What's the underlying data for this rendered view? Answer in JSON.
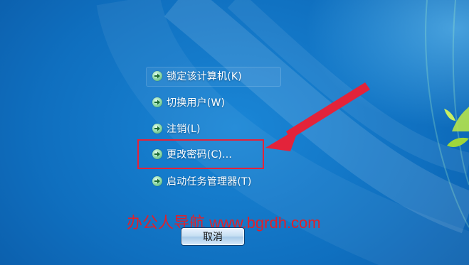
{
  "menu": {
    "items": [
      {
        "label": "锁定该计算机(K)",
        "icon": "green-arrow-icon"
      },
      {
        "label": "切换用户(W)",
        "icon": "green-arrow-icon"
      },
      {
        "label": "注销(L)",
        "icon": "green-arrow-icon"
      },
      {
        "label": "更改密码(C)...",
        "icon": "green-arrow-icon"
      },
      {
        "label": "启动任务管理器(T)",
        "icon": "green-arrow-icon"
      }
    ]
  },
  "watermark": {
    "text": "办公人导航 www.bgrdh.com",
    "color": "#e0202a"
  },
  "cancel": {
    "label": "取消"
  },
  "colors": {
    "background": "#0f6fbf",
    "highlight": "#e3233a",
    "arrow": "#3fa465"
  }
}
